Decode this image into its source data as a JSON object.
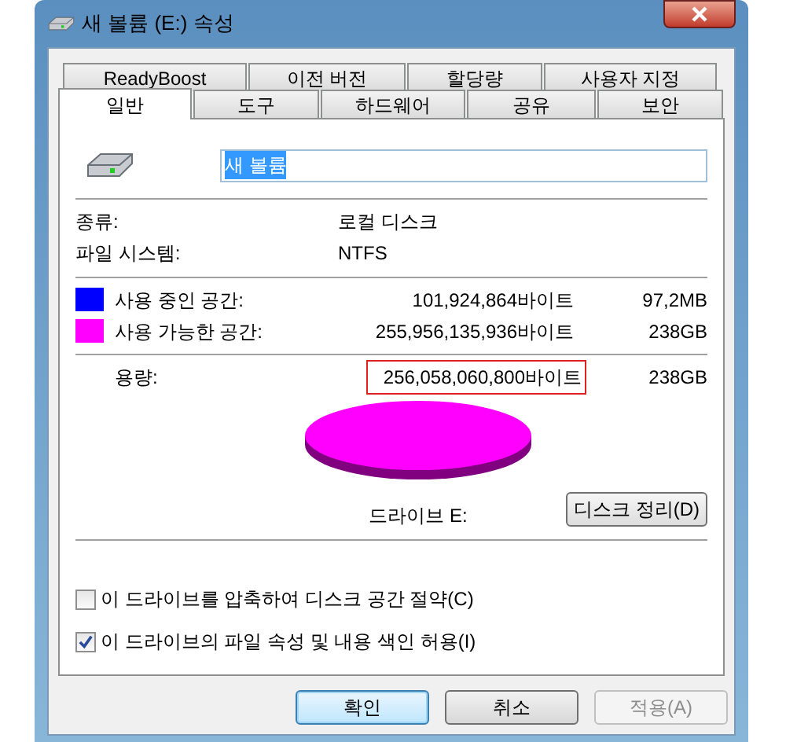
{
  "window": {
    "title": "새 볼륨 (E:) 속성"
  },
  "tab_rows": [
    [
      {
        "label": "ReadyBoost",
        "selected": false
      },
      {
        "label": "이전 버전",
        "selected": false
      },
      {
        "label": "할당량",
        "selected": false
      },
      {
        "label": "사용자 지정",
        "selected": false
      }
    ],
    [
      {
        "label": "일반",
        "selected": true
      },
      {
        "label": "도구",
        "selected": false
      },
      {
        "label": "하드웨어",
        "selected": false
      },
      {
        "label": "공유",
        "selected": false
      },
      {
        "label": "보안",
        "selected": false
      }
    ]
  ],
  "volume_name": {
    "value": "새 볼륨",
    "text_selected": true
  },
  "info": [
    {
      "label": "종류:",
      "value": "로컬 디스크"
    },
    {
      "label": "파일 시스템:",
      "value": "NTFS"
    }
  ],
  "space": [
    {
      "label": "사용 중인 공간:",
      "bytes": "101,924,864바이트",
      "size": "97,2MB",
      "color": "#0000ff"
    },
    {
      "label": "사용 가능한 공간:",
      "bytes": "255,956,135,936바이트",
      "size": "238GB",
      "color": "#ff00ff"
    }
  ],
  "capacity": {
    "label": "용량:",
    "bytes": "256,058,060,800바이트",
    "size": "238GB",
    "outlined": true
  },
  "drive_label": "드라이브 E:",
  "cleanup_button": "디스크 정리(D)",
  "options": [
    {
      "label": "이 드라이브를 압축하여 디스크 공간 절약(C)",
      "checked": false
    },
    {
      "label": "이 드라이브의 파일 속성 및 내용 색인 허용(I)",
      "checked": true
    }
  ],
  "buttons": [
    {
      "label": "확인",
      "default": true,
      "disabled": false
    },
    {
      "label": "취소",
      "default": false,
      "disabled": false
    },
    {
      "label": "적용(A)",
      "default": false,
      "disabled": true
    }
  ]
}
